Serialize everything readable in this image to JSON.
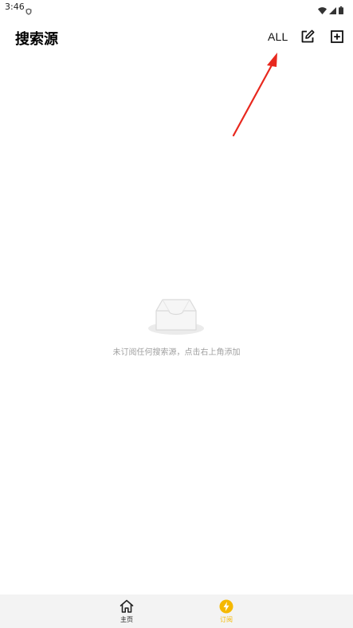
{
  "status_bar": {
    "time": "3:46"
  },
  "app_bar": {
    "title": "搜索源",
    "all_label": "ALL",
    "edit_icon": "edit-square-icon",
    "add_icon": "add-box-icon"
  },
  "empty_state": {
    "icon": "empty-inbox-icon",
    "message": "未订阅任何搜索源，点击右上角添加"
  },
  "bottom_nav": {
    "items": [
      {
        "label": "主页",
        "icon": "home-icon",
        "active": false
      },
      {
        "label": "订阅",
        "icon": "lightning-icon",
        "active": true
      }
    ],
    "active_color": "#f5b800"
  },
  "colors": {
    "annotation": "#e8281e",
    "accent": "#f5b800"
  }
}
